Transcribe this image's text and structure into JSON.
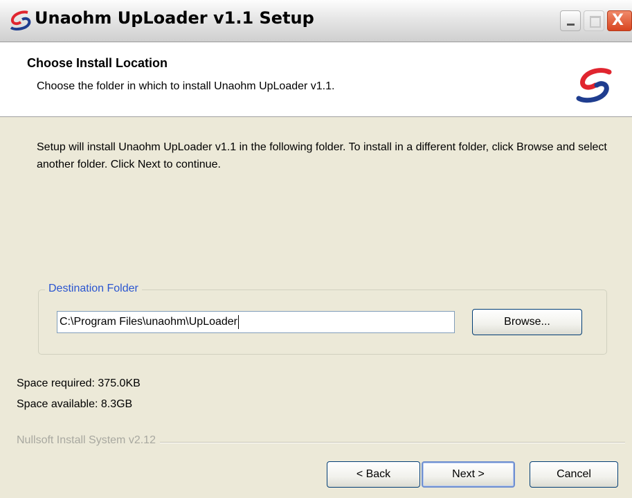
{
  "window": {
    "title": "Unaohm UpLoader v1.1 Setup",
    "controls": {
      "minimize_icon": "minimize-icon",
      "maximize_icon": "maximize-icon",
      "close_icon": "close-icon",
      "close_glyph": "X"
    }
  },
  "header": {
    "title": "Choose Install Location",
    "subtitle": "Choose the folder in which to install Unaohm UpLoader v1.1.",
    "logo_icon": "unaohm-logo-icon"
  },
  "description": "Setup will install Unaohm UpLoader v1.1 in the following folder. To install in a different folder, click Browse and select another folder. Click Next to continue.",
  "destination": {
    "legend": "Destination Folder",
    "path": "C:\\Program Files\\unaohm\\UpLoader",
    "browse_label": "Browse..."
  },
  "space": {
    "required": "Space required: 375.0KB",
    "available": "Space available: 8.3GB"
  },
  "branding": "Nullsoft Install System v2.12",
  "buttons": {
    "back": "< Back",
    "next": "Next >",
    "cancel": "Cancel"
  },
  "colors": {
    "accent_red": "#e0252f",
    "accent_blue": "#1f3d8f",
    "legend_blue": "#2a55d0",
    "dialog_bg": "#ece9d8"
  }
}
